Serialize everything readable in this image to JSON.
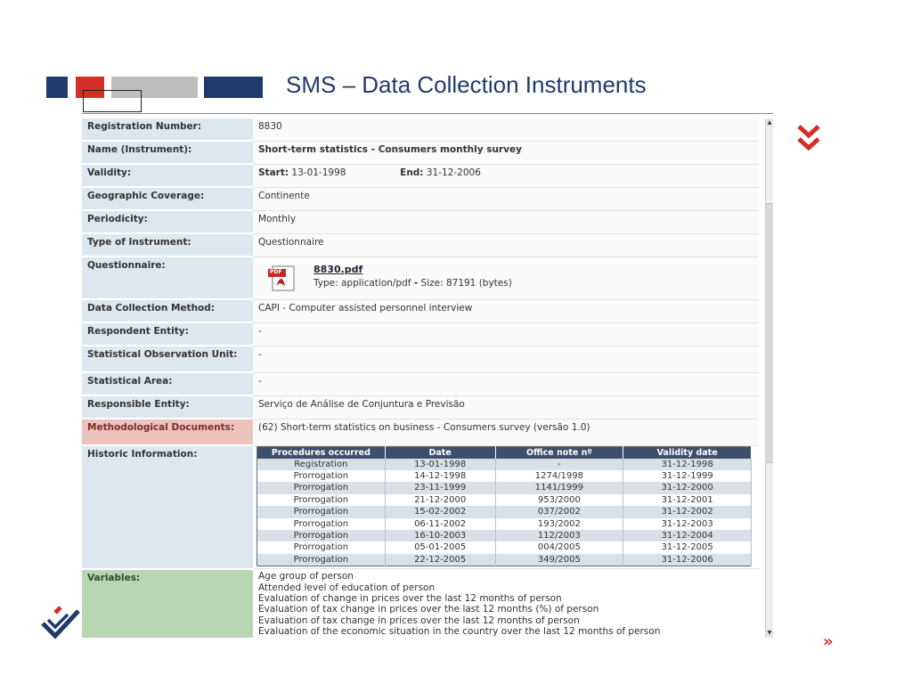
{
  "slide": {
    "title": "SMS – Data Collection Instruments",
    "next_label": "»"
  },
  "colors": {
    "navy": "#1f3a6b",
    "red": "#d32f26",
    "gray": "#bdbdbd",
    "label_bg": "#dde7ef",
    "methodological_bg": "#ecc2bd",
    "variables_bg": "#b9d6b2",
    "history_header": "#3d4f6a"
  },
  "fields": {
    "registration_number": {
      "label": "Registration Number:",
      "value": "8830"
    },
    "name": {
      "label": "Name (Instrument):",
      "value": "Short-term statistics - Consumers monthly survey"
    },
    "validity": {
      "label": "Validity:",
      "start_label": "Start:",
      "start": "13-01-1998",
      "end_label": "End:",
      "end": "31-12-2006"
    },
    "geographic": {
      "label": "Geographic Coverage:",
      "value": "Continente"
    },
    "periodicity": {
      "label": "Periodicity:",
      "value": "Monthly"
    },
    "type": {
      "label": "Type of Instrument:",
      "value": "Questionnaire"
    },
    "questionnaire": {
      "label": "Questionnaire:",
      "file_name": "8830.pdf",
      "type_label": "Type: application/pdf",
      "separator": "-",
      "size_label": "Size: 87191 (bytes)",
      "icon": "pdf-file-icon",
      "icon_text": "PDF"
    },
    "method": {
      "label": "Data Collection Method:",
      "value": "CAPI - Computer assisted personnel interview"
    },
    "respondent": {
      "label": "Respondent Entity:",
      "value": "-"
    },
    "observation_unit": {
      "label": "Statistical Observation Unit:",
      "value": "-"
    },
    "area": {
      "label": "Statistical Area:",
      "value": "-"
    },
    "responsible": {
      "label": "Responsible Entity:",
      "value": "Serviço de Análise de Conjuntura e Previsão"
    },
    "methodological": {
      "label": "Methodological Documents:",
      "value": "(62) Short-term statistics on business - Consumers survey (versão 1.0)"
    },
    "historic": {
      "label": "Historic Information:"
    },
    "variables": {
      "label": "Variables:"
    }
  },
  "history": {
    "headers": [
      "Procedures occurred",
      "Date",
      "Office note nº",
      "Validity date"
    ],
    "rows": [
      [
        "Registration",
        "13-01-1998",
        "-",
        "31-12-1998"
      ],
      [
        "Prorrogation",
        "14-12-1998",
        "1274/1998",
        "31-12-1999"
      ],
      [
        "Prorrogation",
        "23-11-1999",
        "1141/1999",
        "31-12-2000"
      ],
      [
        "Prorrogation",
        "21-12-2000",
        "953/2000",
        "31-12-2001"
      ],
      [
        "Prorrogation",
        "15-02-2002",
        "037/2002",
        "31-12-2002"
      ],
      [
        "Prorrogation",
        "06-11-2002",
        "193/2002",
        "31-12-2003"
      ],
      [
        "Prorrogation",
        "16-10-2003",
        "112/2003",
        "31-12-2004"
      ],
      [
        "Prorrogation",
        "05-01-2005",
        "004/2005",
        "31-12-2005"
      ],
      [
        "Prorrogation",
        "22-12-2005",
        "349/2005",
        "31-12-2006"
      ]
    ]
  },
  "variables": [
    "Age group of person",
    "Attended level of education of person",
    "Evaluation of change in prices over the last 12 months of person",
    "Evaluation of tax change in prices over the last 12 months (%) of person",
    "Evaluation of tax change in prices over the last 12 months of person",
    "Evaluation of the economic situation in the country over the last 12 months of person"
  ]
}
